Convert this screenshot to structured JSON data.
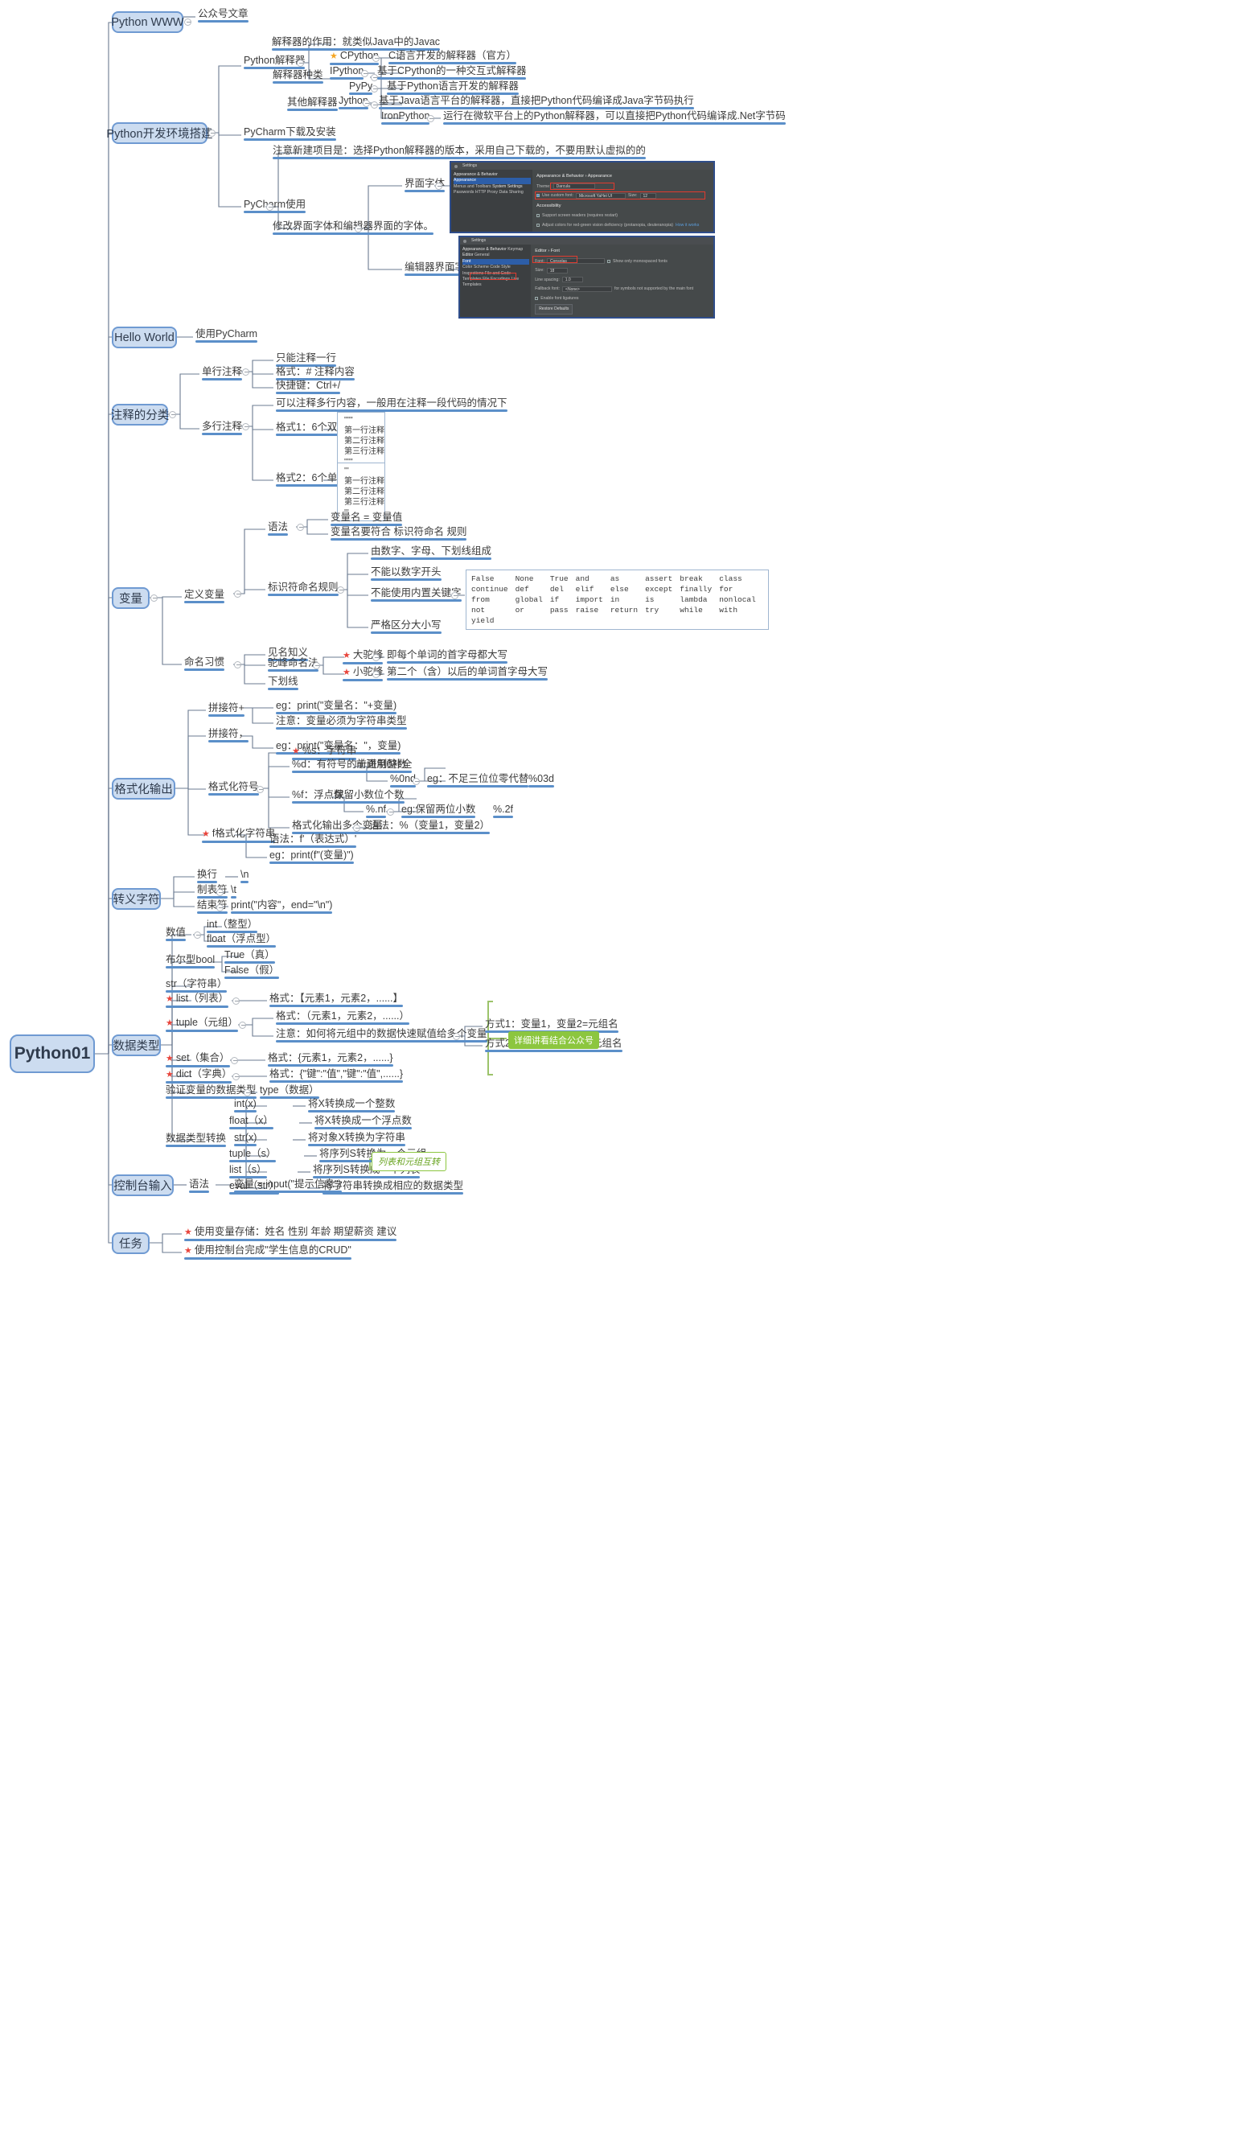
{
  "root": {
    "label": "Python01"
  },
  "colors": {
    "branch": "#5b8fc9",
    "box_fill": "#ccdcf0",
    "box_border": "#6f9ad2",
    "star": "#f5a623",
    "star_red": "#e8453c",
    "green": "#8cc63f"
  },
  "topics": {
    "python_www": "Python WWW",
    "env_setup": "Python开发环境搭建",
    "hello_world": "Hello World",
    "comment_types": "注释的分类",
    "variable": "变量",
    "format_output": "格式化输出",
    "escape_char": "转义字符",
    "data_type": "数据类型",
    "console_input": "控制台输入",
    "task": "任务"
  },
  "python_www": {
    "children": [
      "公众号文章"
    ]
  },
  "env_setup": {
    "interpreter": "Python解释器",
    "interpreter_role": "解释器的作用：就类似Java中的Javac",
    "interpreter_kinds": "解释器种类",
    "other_interpreters": "其他解释器",
    "kinds": [
      {
        "name": "CPython",
        "star": true,
        "desc": "C语言开发的解释器（官方）"
      },
      {
        "name": "IPython",
        "star": false,
        "desc": "基于CPython的一种交互式解释器"
      }
    ],
    "others": [
      {
        "name": "PyPy",
        "desc": "基于Python语言开发的解释器"
      },
      {
        "name": "Jython",
        "desc": "基于Java语言平台的解释器，直接把Python代码编译成Java字节码执行"
      },
      {
        "name": "IronPython",
        "desc": "运行在微软平台上的Python解释器，可以直接把Python代码编译成.Net字节码"
      }
    ],
    "pycharm_download": "PyCharm下载及安装",
    "pycharm_use": "PyCharm使用",
    "pycharm_note": "注意新建项目是：选择Python解释器的版本，采用自己下载的，不要用默认虚拟的的",
    "pycharm_font_note": "修改界面字体和编辑器界面的字体。",
    "ui_font": "界面字体",
    "editor_font": "编辑器界面字体"
  },
  "settings_shot_1": {
    "title": "Settings",
    "breadcrumb": "Appearance & Behavior  ›  Appearance",
    "tree": [
      "Appearance & Behavior",
      "Appearance",
      "Menus and Toolbars",
      "System Settings",
      "Passwords",
      "HTTP Proxy",
      "Data Sharing"
    ],
    "theme_label": "Theme:",
    "theme_value": "Darcula",
    "custom_font_label": "Use custom font:",
    "custom_font_value": "Microsoft YaHei UI",
    "size_label": "Size:",
    "size_value": "12",
    "accessibility": "Accessibility",
    "opt1": "Support screen readers (requires restart)",
    "opt2": "Adjust colors for red-green vision deficiency (protanopia, deuteranopia)",
    "how_it_works": "How it works"
  },
  "settings_shot_2": {
    "title": "Settings",
    "breadcrumb": "Editor  ›  Font",
    "tree": [
      "Appearance & Behavior",
      "Keymap",
      "Editor",
      "General",
      "Font",
      "Color Scheme",
      "Code Style",
      "Inspections",
      "File and Code Templates",
      "File Encodings",
      "Live Templates"
    ],
    "font_label": "Font:",
    "font_value": "Consolas",
    "monospaced_label": "Show only monospaced fonts",
    "size_label": "Size:",
    "size_value": "18",
    "line_spacing_label": "Line spacing:",
    "line_spacing_value": "1.0",
    "fallback_label": "Fallback font:",
    "fallback_value": "<None>",
    "fallback_hint": "for symbols not supported by the main font",
    "ligatures_label": "Enable font ligatures",
    "restore_btn": "Restore Defaults"
  },
  "hello_world": {
    "children": [
      "使用PyCharm"
    ]
  },
  "comment_types": {
    "single": "单行注释",
    "single_children": [
      "只能注释一行",
      "格式：# 注释内容",
      "快捷键：Ctrl+/"
    ],
    "multi": "多行注释",
    "multi_note": "可以注释多行内容，一般用在注释一段代码的情况下",
    "fmt1": "格式1：6个双引号",
    "fmt1_sample": [
      "\"\"\"",
      "第一行注释",
      "第二行注释",
      "第三行注释",
      "\"\"\""
    ],
    "fmt2": "格式2：6个单引号",
    "fmt2_sample": [
      "'''",
      "第一行注释",
      "第二行注释",
      "第三行注释",
      "'''"
    ]
  },
  "variable": {
    "define": "定义变量",
    "syntax": "语法",
    "syntax_items": [
      "变量名 = 变量值",
      "变量名要符合 标识符命名 规则"
    ],
    "identifier_rule": "标识符命名规则",
    "rules": [
      "由数字、字母、下划线组成",
      "不能以数字开头",
      "不能使用内置关键字",
      "严格区分大小写"
    ],
    "keywords": [
      [
        "False",
        "None",
        "True",
        "and",
        "as",
        "assert",
        "break",
        "class"
      ],
      [
        "continue",
        "def",
        "del",
        "elif",
        "else",
        "except",
        "finally",
        "for"
      ],
      [
        "from",
        "global",
        "if",
        "import",
        "in",
        "is",
        "lambda",
        "nonlocal"
      ],
      [
        "not",
        "or",
        "pass",
        "raise",
        "return",
        "try",
        "while",
        "with"
      ],
      [
        "yield",
        "",
        "",
        "",
        "",
        "",
        "",
        ""
      ]
    ],
    "naming_habit": "命名习惯",
    "habit_items": [
      "见名知义",
      "下划线"
    ],
    "camel": "驼峰命名法",
    "big_camel": "大驼峰",
    "big_camel_desc": "即每个单词的首字母都大写",
    "small_camel": "小驼峰",
    "small_camel_desc": "第二个（含）以后的单词首字母大写"
  },
  "format_output": {
    "concat_plus": "拼接符+",
    "concat_plus_items": [
      "eg：print(\"变量名：\"+变量)",
      "注意：变量必须为字符串类型"
    ],
    "concat_comma": "拼接符，",
    "concat_comma_items": [
      "eg：print(\"变量名：\"，变量)"
    ],
    "format_symbol": "格式化符号",
    "pct_s": {
      "label": "%s：字符串",
      "star": true
    },
    "pct_d": {
      "label": "%d：有符号的十进制整数"
    },
    "pct_d_child": {
      "label": "%0nd",
      "note": "前面用0补全",
      "eg": "eg：不足三位位零代替",
      "val": "%03d"
    },
    "pct_f": {
      "label": "%f：浮点数"
    },
    "pct_f_child": {
      "label": "%.nf",
      "note": "保留小数位个数",
      "eg": "eg:保留两位小数",
      "val": "%.2f"
    },
    "multi_var": "格式化输出多个变量",
    "multi_var_syntax": "语法：%（变量1，变量2）",
    "fstring": {
      "label": "f格式化字符串",
      "star": true
    },
    "fstring_items": [
      "语法：f'（表达式）'",
      "eg：print(f\"(变量)\")"
    ]
  },
  "escape_char": {
    "items": [
      {
        "label": "换行",
        "value": "\\n"
      },
      {
        "label": "制表符",
        "value": "\\t"
      },
      {
        "label": "结束符",
        "value": "print(\"内容\"，end=\"\\n\")"
      }
    ]
  },
  "data_type": {
    "numeric": "数值",
    "numeric_items": [
      "int（整型）",
      "float（浮点型）"
    ],
    "bool": "布尔型bool",
    "bool_items": [
      "True（真）",
      "False（假）"
    ],
    "str": "str（字符串）",
    "list": {
      "label": "list（列表）",
      "star": true,
      "fmt": "格式：【元素1，元素2，......】"
    },
    "tuple": {
      "label": "tuple（元组）",
      "star": true,
      "fmt": "格式：（元素1，元素2，......）",
      "note": "注意：如何将元组中的数据快速赋值给多个变量",
      "ways": [
        "方式1：变量1，变量2=元组名",
        "方式2：变量1，*变量2=元组名"
      ]
    },
    "set": {
      "label": "set（集合）",
      "star": true,
      "fmt": "格式：{元素1，元素2，......}"
    },
    "dict": {
      "label": "dict（字典）",
      "star": true,
      "fmt": "格式：{\"键\":\"值\",\"键\":\"值\",......}"
    },
    "verify": "验证变量的数据类型",
    "verify_child": "type（数据）",
    "convert": "数据类型转换",
    "converts": [
      {
        "fn": "int(x)",
        "desc": "将X转换成一个整数"
      },
      {
        "fn": "float（x）",
        "desc": "将X转换成一个浮点数"
      },
      {
        "fn": "str(x)",
        "desc": "将对象X转换为字符串"
      },
      {
        "fn": "tuple（s）",
        "desc": "将序列S转换为一个元组"
      },
      {
        "fn": "list（s）",
        "desc": "将序列S转换成一个列表"
      },
      {
        "fn": "eval（str）",
        "desc": "将字符串转换成相应的数据类型"
      }
    ],
    "green_note_right": "详细讲看结合公众号",
    "green_note_convert": "列表和元组互转"
  },
  "console_input": {
    "syntax": "语法",
    "syntax_value": "变量 = input(\"提示信息\")"
  },
  "task": {
    "items": [
      {
        "star": true,
        "text": "使用变量存储：姓名 性别 年龄 期望薪资 建议"
      },
      {
        "star": true,
        "text": "使用控制台完成\"学生信息的CRUD\""
      }
    ]
  }
}
